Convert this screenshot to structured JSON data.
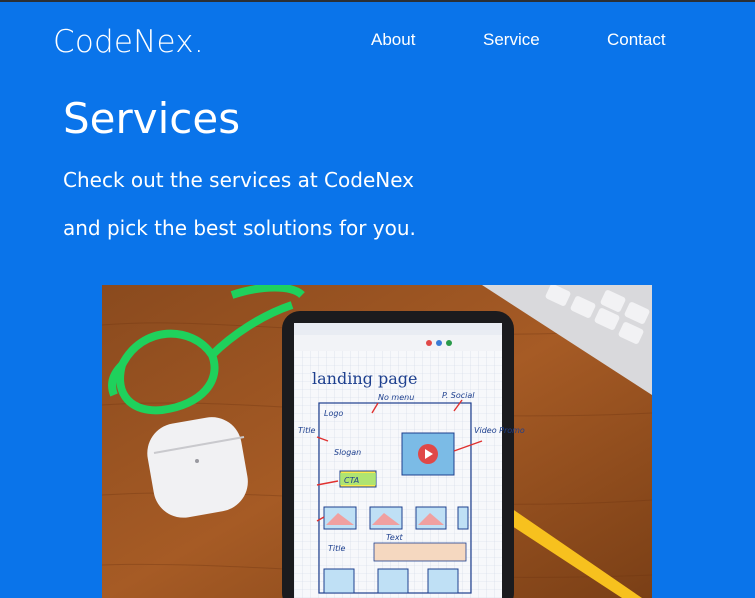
{
  "brand": {
    "logo": "CodeNex."
  },
  "nav": {
    "items": [
      "About",
      "Service",
      "Contact"
    ]
  },
  "hero": {
    "title": "Services",
    "line1": "Check out the services at CodeNex",
    "line2": "and pick the best solutions for you.",
    "image": {
      "sketch_title": "landing page",
      "labels": [
        "Logo",
        "No menu",
        "P. Social",
        "Title",
        "Slogan",
        "CTA",
        "Video Promo",
        "Title",
        "Text"
      ]
    }
  },
  "colors": {
    "background": "#0a74ea",
    "text": "#ffffff",
    "topbar": "#2a2f36"
  }
}
